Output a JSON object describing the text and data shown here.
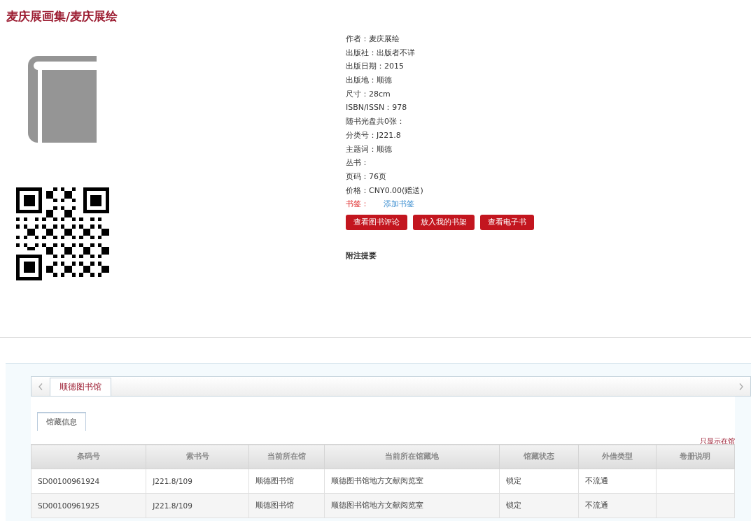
{
  "title": "麦庆展画集/麦庆展绘",
  "details": [
    {
      "label": "作者：",
      "value": "麦庆展绘"
    },
    {
      "label": "出版社：",
      "value": "出版者不详"
    },
    {
      "label": "出版日期：",
      "value": "2015"
    },
    {
      "label": "出版地：",
      "value": "顺德"
    },
    {
      "label": "尺寸：",
      "value": "28cm"
    },
    {
      "label": "ISBN/ISSN：",
      "value": "978"
    },
    {
      "label": "随书光盘共0张："
    },
    {
      "label": "分类号：",
      "value": "J221.8"
    },
    {
      "label": "主题词：",
      "value": "顺德"
    },
    {
      "label": "丛书："
    },
    {
      "label": "页码：",
      "value": "76页"
    },
    {
      "label": "价格：",
      "value": "CNY0.00(赠送)"
    }
  ],
  "bookmark": {
    "label": "书签：",
    "link": "添加书签"
  },
  "buttons": [
    "查看图书评论",
    "放入我的书架",
    "查看电子书"
  ],
  "notes_heading": "附注提要",
  "library_tabs": [
    {
      "label": "顺德图书馆",
      "selected": true
    }
  ],
  "sub_tabs": [
    {
      "label": "馆藏信息",
      "selected": true
    }
  ],
  "filter_link": "只显示在馆",
  "table": {
    "columns": [
      "条码号",
      "索书号",
      "当前所在馆",
      "当前所在馆藏地",
      "馆藏状态",
      "外借类型",
      "卷册说明"
    ],
    "rows": [
      [
        "SD00100961924",
        "J221.8/109",
        "顺德图书馆",
        "顺德图书馆地方文献阅览室",
        "锁定",
        "不流通",
        ""
      ],
      [
        "SD00100961925",
        "J221.8/109",
        "顺德图书馆",
        "顺德图书馆地方文献阅览室",
        "锁定",
        "不流通",
        ""
      ]
    ]
  }
}
